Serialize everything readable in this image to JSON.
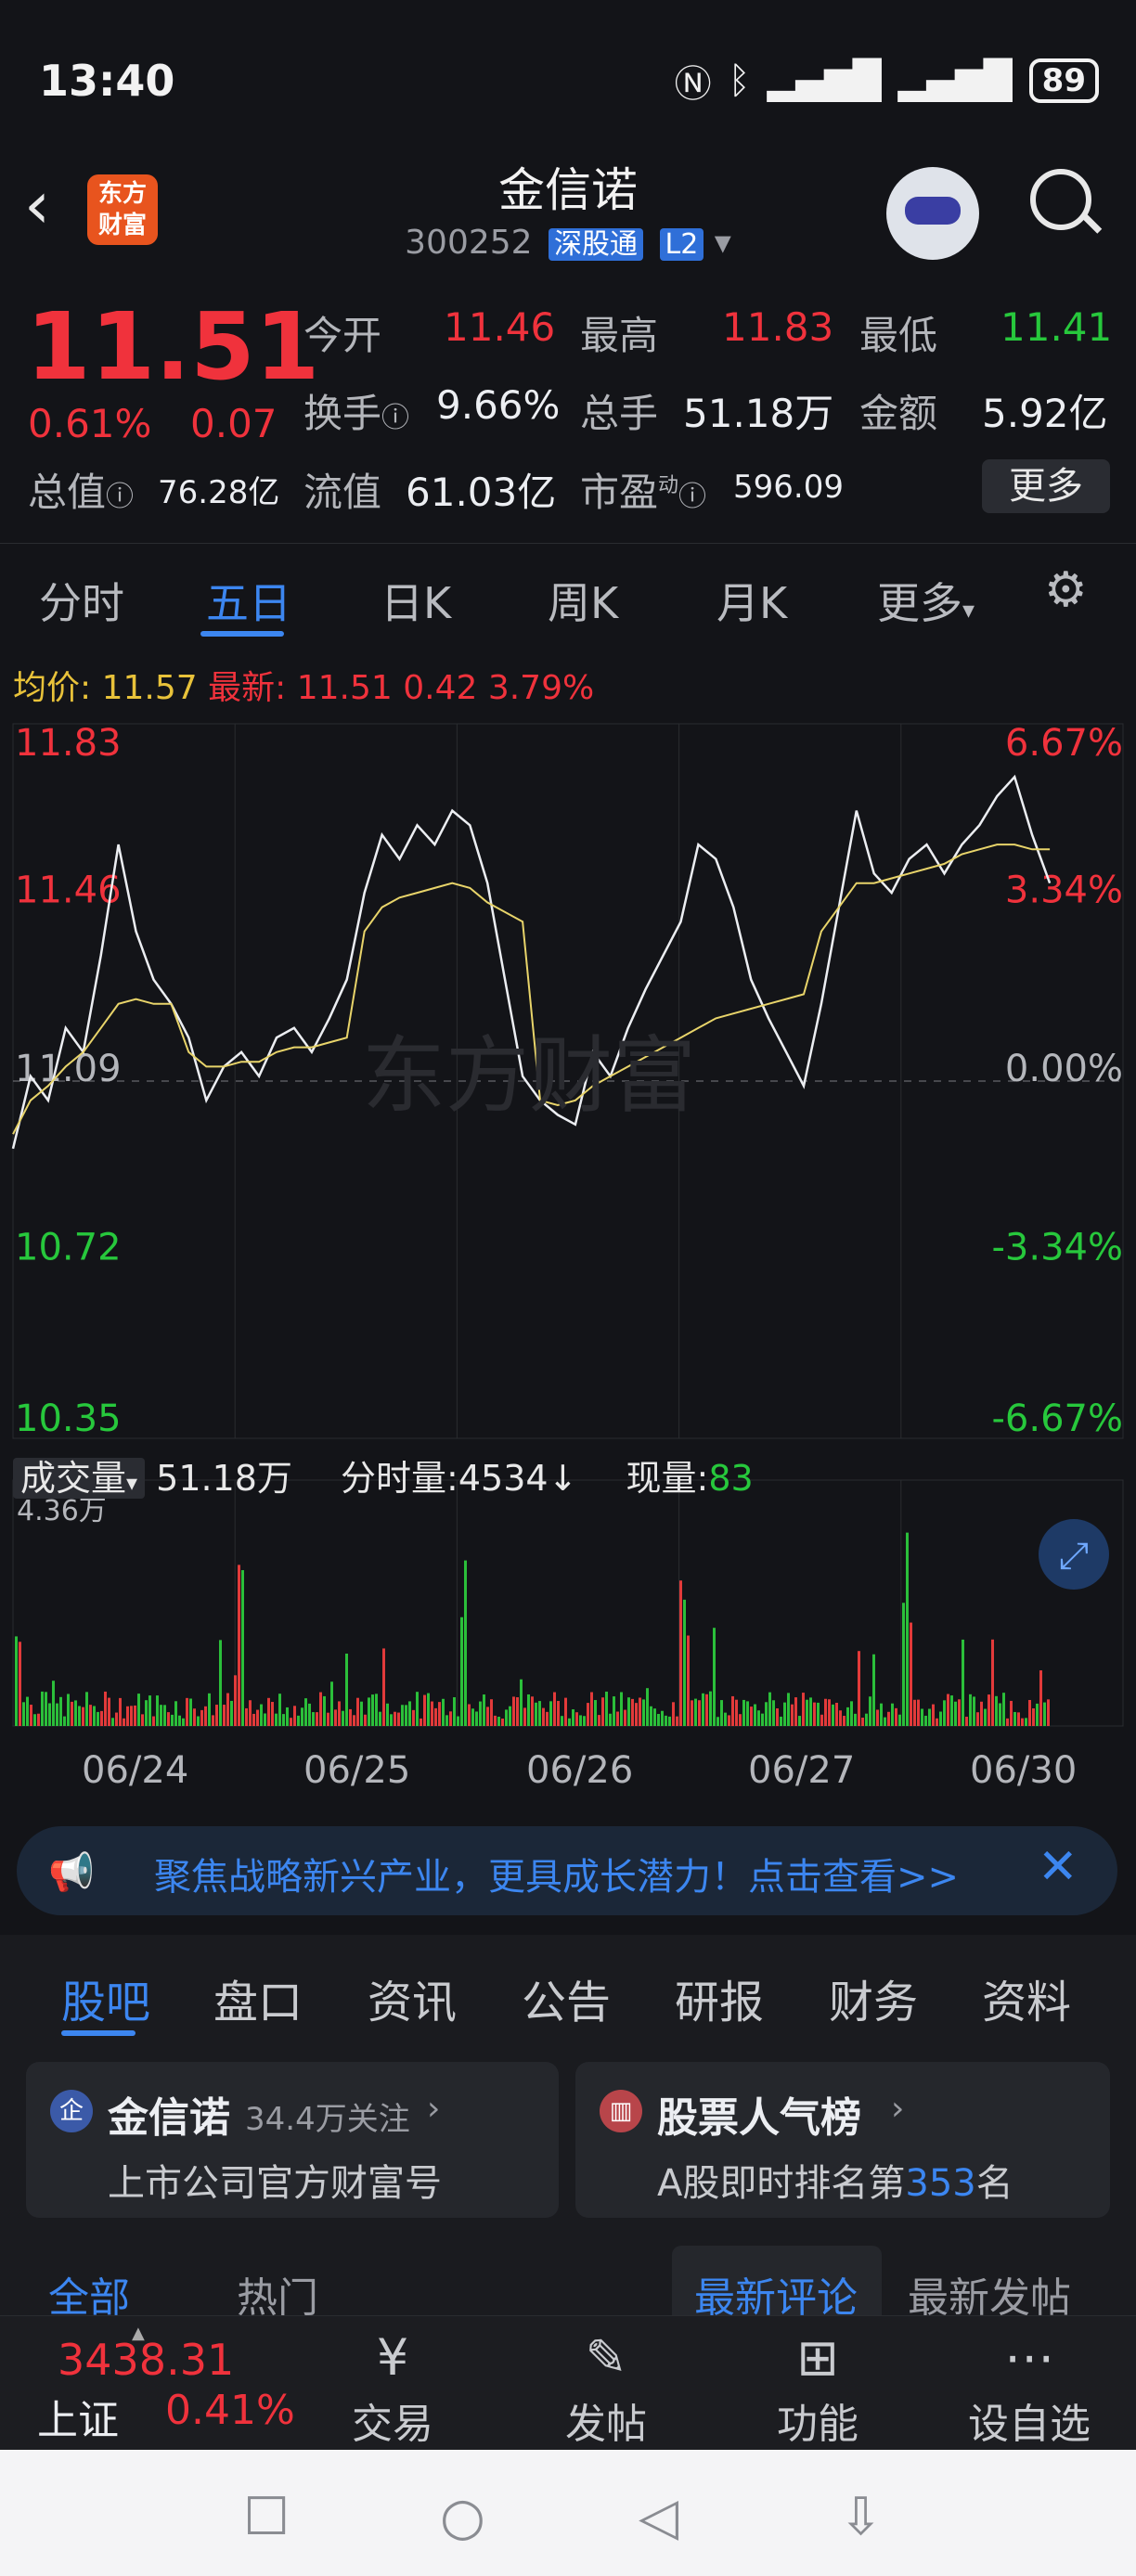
{
  "status_bar": {
    "time": "13:40",
    "battery": "89",
    "icons": [
      "nfc-icon",
      "bluetooth-icon",
      "signal-icon",
      "signal-icon",
      "battery-icon"
    ]
  },
  "header": {
    "stock_name": "金信诺",
    "code": "300252",
    "tag1": "深股通",
    "tag2": "L2",
    "logo_line1": "东方",
    "logo_line2": "财富"
  },
  "quote": {
    "price": "11.51",
    "pct": "0.61%",
    "change": "0.07",
    "rows": [
      [
        {
          "label": "今开",
          "value": "11.46",
          "color": "red"
        },
        {
          "label": "最高",
          "value": "11.83",
          "color": "red"
        },
        {
          "label": "最低",
          "value": "11.41",
          "color": "green"
        }
      ],
      [
        {
          "label": "换手",
          "value": "9.66%",
          "color": "white"
        },
        {
          "label": "总手",
          "value": "51.18万",
          "color": "white"
        },
        {
          "label": "金额",
          "value": "5.92亿",
          "color": "white"
        }
      ]
    ],
    "total_cap_label": "总值",
    "total_cap": "76.28亿",
    "float_cap_label": "流值",
    "float_cap": "61.03亿",
    "pe_label": "市盈",
    "pe_sup": "动",
    "pe": "596.09",
    "more": "更多"
  },
  "tabs": [
    "分时",
    "五日",
    "日K",
    "周K",
    "月K",
    "更多"
  ],
  "active_tab": "五日",
  "chart_summary": {
    "avg_label": "均价:",
    "avg_value": "11.57",
    "latest_label": "最新:",
    "latest_value": "11.51",
    "latest_change": "0.42",
    "latest_pct": "3.79%"
  },
  "chart_data": {
    "type": "line",
    "title": "",
    "x_categories": [
      "06/24",
      "06/25",
      "06/26",
      "06/27",
      "06/30"
    ],
    "y_ticks_left": [
      "11.83",
      "11.46",
      "11.09",
      "10.72",
      "10.35"
    ],
    "y_ticks_right": [
      "6.67%",
      "3.34%",
      "0.00%",
      "-3.34%",
      "-6.67%"
    ],
    "ylim": [
      10.35,
      11.83
    ],
    "baseline": 11.09,
    "series": [
      {
        "values": [
          10.95,
          11.1,
          11.05,
          11.2,
          11.15,
          11.35,
          11.58,
          11.4,
          11.3,
          11.25,
          11.18,
          11.05,
          11.12,
          11.15,
          11.1,
          11.18,
          11.2,
          11.15,
          11.22,
          11.3,
          11.48,
          11.6,
          11.55,
          11.62,
          11.58,
          11.65,
          11.62,
          11.5,
          11.3,
          11.1,
          11.05,
          11.02,
          11.0,
          11.15,
          11.1,
          11.2,
          11.28,
          11.35,
          11.42,
          11.58,
          11.55,
          11.45,
          11.3,
          11.22,
          11.15,
          11.08,
          11.25,
          11.45,
          11.65,
          11.52,
          11.48,
          11.55,
          11.58,
          11.52,
          11.58,
          11.62,
          11.68,
          11.72,
          11.6,
          11.5
        ]
      },
      {
        "values": [
          10.98,
          11.05,
          11.08,
          11.12,
          11.15,
          11.2,
          11.25,
          11.26,
          11.25,
          11.25,
          11.15,
          11.12,
          11.12,
          11.13,
          11.13,
          11.15,
          11.16,
          11.16,
          11.17,
          11.18,
          11.4,
          11.45,
          11.47,
          11.48,
          11.49,
          11.5,
          11.49,
          11.46,
          11.44,
          11.42,
          11.05,
          11.04,
          11.05,
          11.08,
          11.1,
          11.12,
          11.14,
          11.16,
          11.18,
          11.2,
          11.22,
          11.23,
          11.24,
          11.25,
          11.26,
          11.27,
          11.4,
          11.45,
          11.5,
          11.5,
          11.51,
          11.52,
          11.53,
          11.54,
          11.56,
          11.57,
          11.58,
          11.58,
          11.57,
          11.57
        ]
      }
    ],
    "volume": {
      "label": "成交量",
      "total": "51.18万",
      "tick_label": "分时量:4534↓",
      "now_label": "现量:",
      "now_value": "83",
      "ymax_label": "4.36万"
    }
  },
  "banner": {
    "text": "聚焦战略新兴产业，更具成长潜力！点击查看>>"
  },
  "section_tabs": [
    "股吧",
    "盘口",
    "资讯",
    "公告",
    "研报",
    "财务",
    "资料"
  ],
  "cards": [
    {
      "title": "金信诺",
      "meta": "34.4万关注",
      "sub": "上市公司官方财富号",
      "badge": "企"
    },
    {
      "title": "股票人气榜",
      "sub_prefix": "A股即时排名第",
      "rank": "353",
      "sub_suffix": "名"
    }
  ],
  "feed_tabs": [
    "全部",
    "热门",
    "最新评论",
    "最新发帖"
  ],
  "bottom_nav": {
    "index_value": "3438.31",
    "index_name": "上证",
    "index_pct": "0.41%",
    "items": [
      "交易",
      "发帖",
      "功能",
      "设自选"
    ]
  }
}
